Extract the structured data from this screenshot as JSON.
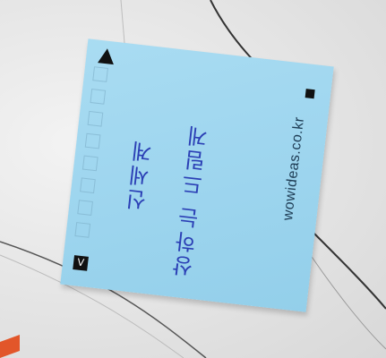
{
  "sticky_note": {
    "handwriting_line_1": "신세계",
    "handwriting_line_2": "상하는 드림게",
    "brand_url": "wowideas.co.kr",
    "badge_glyph": "V",
    "note_color": "#9fd6ef",
    "ink_color": "#2b3fb5",
    "play_icon": "play-triangle-icon",
    "stop_icon": "stop-square-icon"
  }
}
